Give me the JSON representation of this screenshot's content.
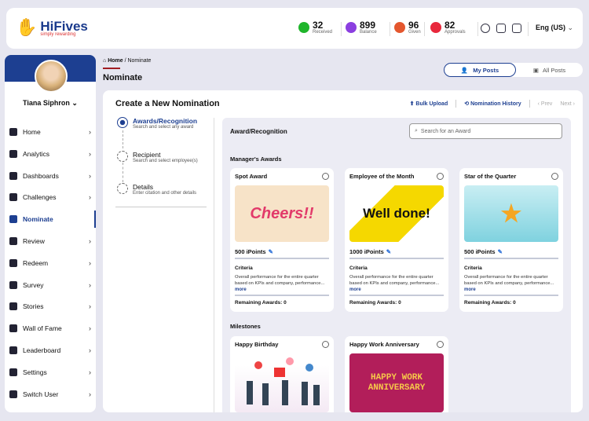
{
  "header": {
    "brand": "HiFives",
    "tagline": "simply rewarding",
    "stats": [
      {
        "value": "32",
        "label": "Received",
        "color": "#1fb52b"
      },
      {
        "value": "899",
        "label": "Balance",
        "color": "#8b3fe0"
      },
      {
        "value": "96",
        "label": "Given",
        "color": "#e4572e"
      },
      {
        "value": "82",
        "label": "Approvals",
        "color": "#e8283c"
      }
    ],
    "language": "Eng (US)"
  },
  "sidebar": {
    "user": "Tiana Siphron",
    "items": [
      {
        "label": "Home"
      },
      {
        "label": "Analytics"
      },
      {
        "label": "Dashboards"
      },
      {
        "label": "Challenges"
      },
      {
        "label": "Nominate",
        "active": true
      },
      {
        "label": "Review"
      },
      {
        "label": "Redeem"
      },
      {
        "label": "Survey"
      },
      {
        "label": "Stories"
      },
      {
        "label": "Wall of Fame"
      },
      {
        "label": "Leaderboard"
      },
      {
        "label": "Settings"
      },
      {
        "label": "Switch User"
      }
    ]
  },
  "breadcrumb": {
    "home": "Home",
    "current": "/ Nominate"
  },
  "page_title": "Nominate",
  "toggle": {
    "my_posts": "My Posts",
    "all_posts": "All Posts"
  },
  "card": {
    "title": "Create a New Nomination",
    "bulk_upload": "Bulk Upload",
    "history": "Nomination History",
    "prev": "Prev",
    "next": "Next"
  },
  "steps": [
    {
      "title": "Awards/Recognition",
      "desc": "Search and select any award"
    },
    {
      "title": "Recipient",
      "desc": "Search and select employee(s)"
    },
    {
      "title": "Details",
      "desc": "Enter citation and other details"
    }
  ],
  "panel": {
    "title": "Award/Recognition",
    "search_placeholder": "Search for an Award",
    "section1": "Manager's Awards",
    "section2": "Milestones"
  },
  "awards": [
    {
      "name": "Spot Award",
      "image_text": "Cheers!!",
      "points": "500 iPoints",
      "criteria": "Criteria",
      "desc": "Overall performance for the entire quarter based on KPIs and company, performance...",
      "more": "more",
      "remaining": "Remaining Awards: 0"
    },
    {
      "name": "Employee of the Month",
      "image_text": "Well done!",
      "points": "1000 iPoints",
      "criteria": "Criteria",
      "desc": "Overall performance for the entire quarter based on KPIs and company, performance...",
      "more": "more",
      "remaining": "Remaining Awards: 0"
    },
    {
      "name": "Star of the Quarter",
      "image_text": "",
      "points": "500 iPoints",
      "criteria": "Criteria",
      "desc": "Overall performance for the entire quarter based on KPIs and company, performance...",
      "more": "more",
      "remaining": "Remaining Awards: 0"
    }
  ],
  "milestones": [
    {
      "name": "Happy Birthday"
    },
    {
      "name": "Happy Work Anniversary",
      "image_text": "HAPPY WORK ANNIVERSARY"
    }
  ]
}
